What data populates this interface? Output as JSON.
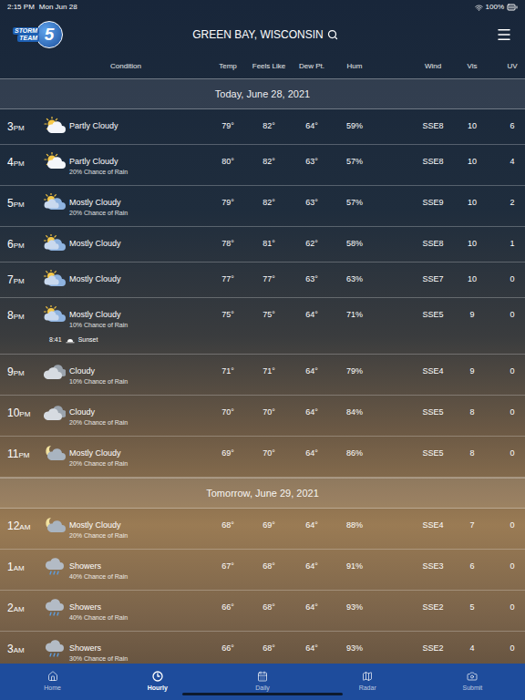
{
  "status_bar": {
    "time": "2:15 PM",
    "date": "Mon Jun 28",
    "battery": "100%"
  },
  "header": {
    "logo": {
      "lines": [
        "STORM",
        "TEAM"
      ],
      "number": "5"
    },
    "location": "GREEN BAY, WISCONSIN"
  },
  "table": {
    "columns": [
      "Condition",
      "Temp",
      "Feels Like",
      "Dew Pt.",
      "Hum",
      "Wind",
      "Vis",
      "UV"
    ],
    "sections": [
      {
        "title": "Today, June 28, 2021",
        "rows": [
          {
            "hour": "3",
            "period": "PM",
            "kind": "partly-cloudy",
            "condition": "Partly Cloudy",
            "temp": "79°",
            "feels": "82°",
            "dew": "64°",
            "hum": "59%",
            "wind": "SSE8",
            "vis": "10",
            "uv": "6"
          },
          {
            "hour": "4",
            "period": "PM",
            "kind": "partly-cloudy",
            "condition": "Partly Cloudy",
            "chance": "20% Chance of Rain",
            "temp": "80°",
            "feels": "82°",
            "dew": "63°",
            "hum": "57%",
            "wind": "SSE8",
            "vis": "10",
            "uv": "4"
          },
          {
            "hour": "5",
            "period": "PM",
            "kind": "mostly-cloudy",
            "condition": "Mostly Cloudy",
            "chance": "20% Chance of Rain",
            "temp": "79°",
            "feels": "82°",
            "dew": "63°",
            "hum": "57%",
            "wind": "SSE9",
            "vis": "10",
            "uv": "2"
          },
          {
            "hour": "6",
            "period": "PM",
            "kind": "mostly-cloudy",
            "condition": "Mostly Cloudy",
            "temp": "78°",
            "feels": "81°",
            "dew": "62°",
            "hum": "58%",
            "wind": "SSE8",
            "vis": "10",
            "uv": "1"
          },
          {
            "hour": "7",
            "period": "PM",
            "kind": "mostly-cloudy",
            "condition": "Mostly Cloudy",
            "temp": "77°",
            "feels": "77°",
            "dew": "63°",
            "hum": "63%",
            "wind": "SSE7",
            "vis": "10",
            "uv": "0"
          },
          {
            "hour": "8",
            "period": "PM",
            "kind": "mostly-cloudy",
            "condition": "Mostly Cloudy",
            "chance": "10% Chance of Rain",
            "temp": "75°",
            "feels": "75°",
            "dew": "64°",
            "hum": "71%",
            "wind": "SSE5",
            "vis": "9",
            "uv": "0",
            "sunset": {
              "time": "8:41",
              "label": "Sunset"
            }
          },
          {
            "hour": "9",
            "period": "PM",
            "kind": "cloudy",
            "condition": "Cloudy",
            "chance": "10% Chance of Rain",
            "temp": "71°",
            "feels": "71°",
            "dew": "64°",
            "hum": "79%",
            "wind": "SSE4",
            "vis": "9",
            "uv": "0"
          },
          {
            "hour": "10",
            "period": "PM",
            "kind": "cloudy",
            "condition": "Cloudy",
            "chance": "20% Chance of Rain",
            "temp": "70°",
            "feels": "70°",
            "dew": "64°",
            "hum": "84%",
            "wind": "SSE5",
            "vis": "8",
            "uv": "0"
          },
          {
            "hour": "11",
            "period": "PM",
            "kind": "mostly-cloudy-night",
            "condition": "Mostly Cloudy",
            "chance": "20% Chance of Rain",
            "temp": "69°",
            "feels": "70°",
            "dew": "64°",
            "hum": "86%",
            "wind": "SSE5",
            "vis": "8",
            "uv": "0"
          }
        ]
      },
      {
        "title": "Tomorrow, June 29, 2021",
        "rows": [
          {
            "hour": "12",
            "period": "AM",
            "kind": "mostly-cloudy-night",
            "condition": "Mostly Cloudy",
            "chance": "20% Chance of Rain",
            "temp": "68°",
            "feels": "69°",
            "dew": "64°",
            "hum": "88%",
            "wind": "SSE4",
            "vis": "7",
            "uv": "0"
          },
          {
            "hour": "1",
            "period": "AM",
            "kind": "showers",
            "condition": "Showers",
            "chance": "40% Chance of Rain",
            "temp": "67°",
            "feels": "68°",
            "dew": "64°",
            "hum": "91%",
            "wind": "SSE3",
            "vis": "6",
            "uv": "0"
          },
          {
            "hour": "2",
            "period": "AM",
            "kind": "showers",
            "condition": "Showers",
            "chance": "40% Chance of Rain",
            "temp": "66°",
            "feels": "68°",
            "dew": "64°",
            "hum": "93%",
            "wind": "SSE2",
            "vis": "5",
            "uv": "0"
          },
          {
            "hour": "3",
            "period": "AM",
            "kind": "showers",
            "condition": "Showers",
            "chance": "30% Chance of Rain",
            "temp": "66°",
            "feels": "68°",
            "dew": "64°",
            "hum": "93%",
            "wind": "SSE2",
            "vis": "4",
            "uv": "0"
          }
        ]
      }
    ]
  },
  "tab_bar": [
    {
      "label": "Home",
      "selected": false
    },
    {
      "label": "Hourly",
      "selected": true
    },
    {
      "label": "Daily",
      "selected": false
    },
    {
      "label": "Radar",
      "selected": false
    },
    {
      "label": "Submit",
      "selected": false
    }
  ]
}
